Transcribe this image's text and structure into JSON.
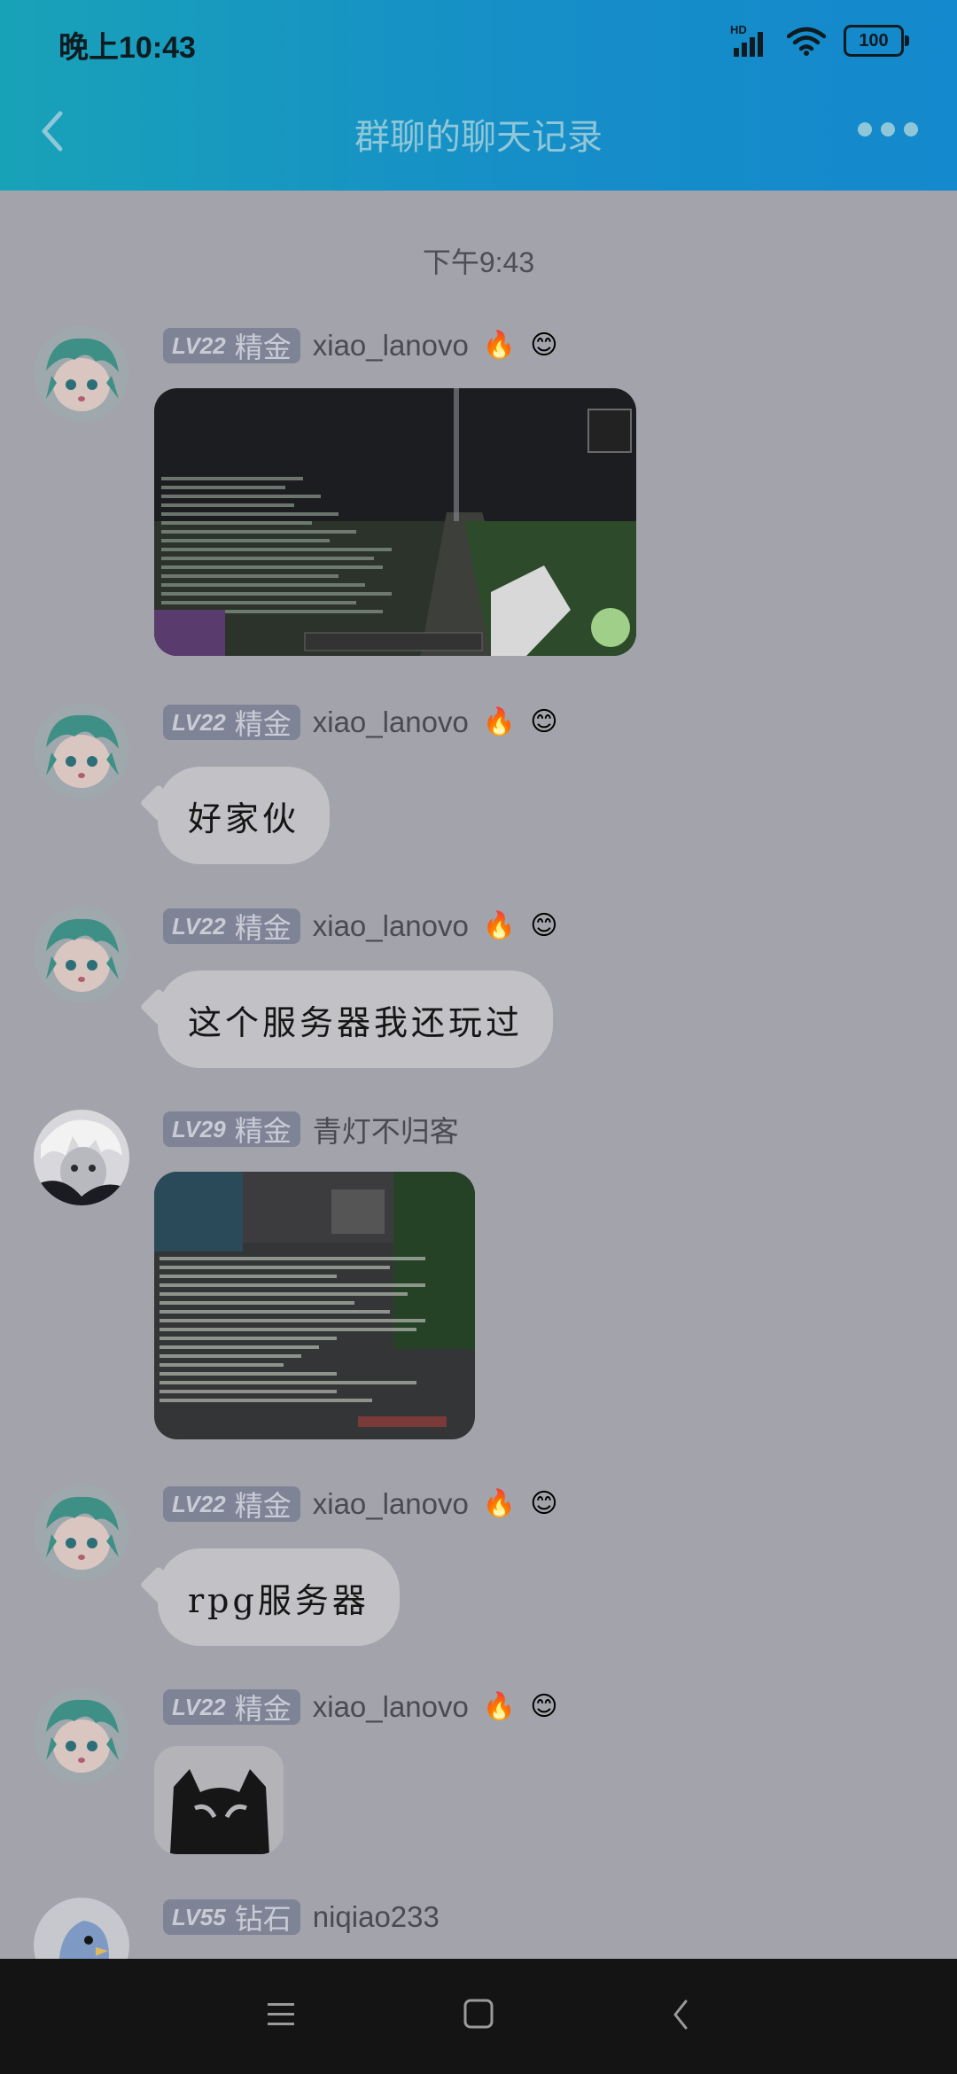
{
  "status_bar": {
    "time": "晚上10:43",
    "network_label": "HD",
    "battery": "100"
  },
  "header": {
    "title": "群聊的聊天记录"
  },
  "chat": {
    "timestamp": "下午9:43",
    "messages": [
      {
        "level": "LV22",
        "rank": "精金",
        "name": "xiao_lanovo",
        "type": "image",
        "image_desc": "minecraft-screenshot"
      },
      {
        "level": "LV22",
        "rank": "精金",
        "name": "xiao_lanovo",
        "type": "text",
        "text": "好家伙"
      },
      {
        "level": "LV22",
        "rank": "精金",
        "name": "xiao_lanovo",
        "type": "text",
        "text": "这个服务器我还玩过"
      },
      {
        "level": "LV29",
        "rank": "精金",
        "name": "青灯不归客",
        "type": "image",
        "image_desc": "minecraft-screenshot"
      },
      {
        "level": "LV22",
        "rank": "精金",
        "name": "xiao_lanovo",
        "type": "text",
        "text": "rpg服务器"
      },
      {
        "level": "LV22",
        "rank": "精金",
        "name": "xiao_lanovo",
        "type": "sticker",
        "image_desc": "cat-sticker"
      },
      {
        "level": "LV55",
        "rank": "钻石",
        "name": "niqiao233",
        "type": "partial"
      }
    ]
  },
  "icons": {
    "back": "chevron-left-icon",
    "more": "more-dots-icon",
    "fire": "fire-icon",
    "flower": "flower-icon",
    "nav_menu": "menu-icon",
    "nav_home": "home-square-icon",
    "nav_back": "back-triangle-icon"
  },
  "colors": {
    "header": "#168ec8",
    "overlay_bg": "#a3a3ab",
    "bubble": "#c1c1c6",
    "badge": "#7f8396"
  }
}
